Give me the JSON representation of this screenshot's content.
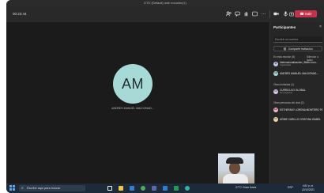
{
  "window": {
    "title": "DTD (Default) web encoder(1)"
  },
  "toolbar": {
    "timer": "00:23:44",
    "leave_label": "Salir",
    "icons": [
      "people-icon",
      "chat-icon",
      "hand-icon",
      "layout-icon",
      "more-icon",
      "camera-icon",
      "mic-icon",
      "share-icon"
    ]
  },
  "stage": {
    "avatar_initials": "AM",
    "presenter_name": "ANDRES MANUEL MALDONAD..."
  },
  "participants": {
    "title": "Participantes",
    "search_placeholder": "Escribir un nombre",
    "share_label": "Compartir invitación",
    "sections": [
      {
        "label": "En esta reunión (8)",
        "action": "Silenciar a todos"
      },
      {
        "label": "Otras invitadas (1)"
      },
      {
        "label": "Otras personas del chat (2)"
      }
    ],
    "people": [
      {
        "name": "Internacionalización | Bellin Icon...",
        "role": "Organizador",
        "initials": "IB",
        "color": "#b9c6f0"
      },
      {
        "name": "ANDRES MANUEL MALDONAD...",
        "role": "",
        "initials": "AM",
        "color": "#a7dad6"
      },
      {
        "name": "CURRICULO GLOBAL",
        "role": "Sin respuesta",
        "initials": "CG",
        "color": "#d8c7f0"
      },
      {
        "name": "ESTHEFANY LORENA MONTERO PESAS",
        "role": "",
        "initials": "EM",
        "color": "#f0b8c2"
      },
      {
        "name": "URIBE CARILLO CRISTINA ISABEL",
        "role": "",
        "initials": "UC",
        "color": "#f2d7a8"
      }
    ]
  },
  "taskbar": {
    "search_placeholder": "Escribe aquí para buscar",
    "weather": "27°C Gran lluvia",
    "lang": "ESP",
    "time": "4:52 p. m.",
    "date": "22/10/2021",
    "apps": [
      {
        "icon": "task-view-icon",
        "color": "#ffffff"
      },
      {
        "icon": "file-explorer-icon",
        "color": "#f4c542"
      },
      {
        "icon": "store-icon",
        "color": "#3a7bd5"
      },
      {
        "icon": "chrome-icon",
        "color": "#4caf50"
      },
      {
        "icon": "teams-icon",
        "color": "#6264a7"
      },
      {
        "icon": "word-icon",
        "color": "#2b7cd3"
      },
      {
        "icon": "excel-icon",
        "color": "#1f9d55"
      },
      {
        "icon": "edge-icon",
        "color": "#2fb5a4"
      }
    ]
  },
  "colors": {
    "leave": "#c4314b",
    "avatar": "#a7dad6",
    "accent": "#5aa9ee"
  }
}
